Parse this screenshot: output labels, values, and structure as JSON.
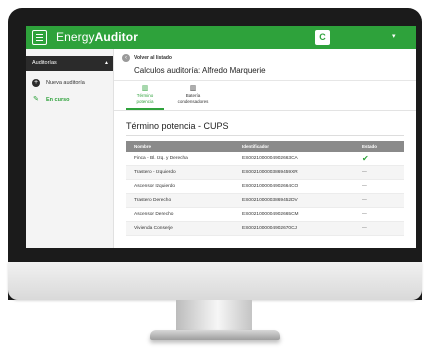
{
  "header": {
    "brand_light": "Energy",
    "brand_bold": "Auditor",
    "user_initial": "C",
    "user_caret": "▾"
  },
  "sidebar": {
    "section_label": "Auditorías",
    "section_caret": "▲",
    "items": [
      {
        "label": "Nueva auditoría",
        "icon": "+"
      },
      {
        "label": "En curso",
        "icon": "✎"
      }
    ]
  },
  "main": {
    "back_label": "Volver al listado",
    "back_icon": "‹",
    "title": "Calculos auditoría: Alfredo Marquerie",
    "tabs": [
      {
        "icon": "▥",
        "line1": "Término",
        "line2": "potencia"
      },
      {
        "icon": "▥",
        "line1": "Batería",
        "line2": "condensadores"
      }
    ],
    "section_title": "Término potencia - CUPS"
  },
  "table": {
    "headers": [
      "Nombre",
      "Identificador",
      "Estado"
    ],
    "rows": [
      {
        "name": "Finca - Bl. Izq. y Derecha",
        "id": "ES0021000004902663CA",
        "status": "✔"
      },
      {
        "name": "Trastero - Izquierdo",
        "id": "ES0021000003869459XR",
        "status": "—"
      },
      {
        "name": "Ascensor Izquierdo",
        "id": "ES0021000004902664CO",
        "status": "—"
      },
      {
        "name": "Trastero Derecho",
        "id": "ES0021000003869452DV",
        "status": "—"
      },
      {
        "name": "Ascensor Derecho",
        "id": "ES0021000004902665CM",
        "status": "—"
      },
      {
        "name": "Vivienda Conserje",
        "id": "ES0021000004902670CJ",
        "status": "—"
      }
    ]
  },
  "colors": {
    "brand_green": "#2ea23b",
    "sidebar_dark": "#2b2b2b",
    "table_header": "#8a8a8a"
  }
}
